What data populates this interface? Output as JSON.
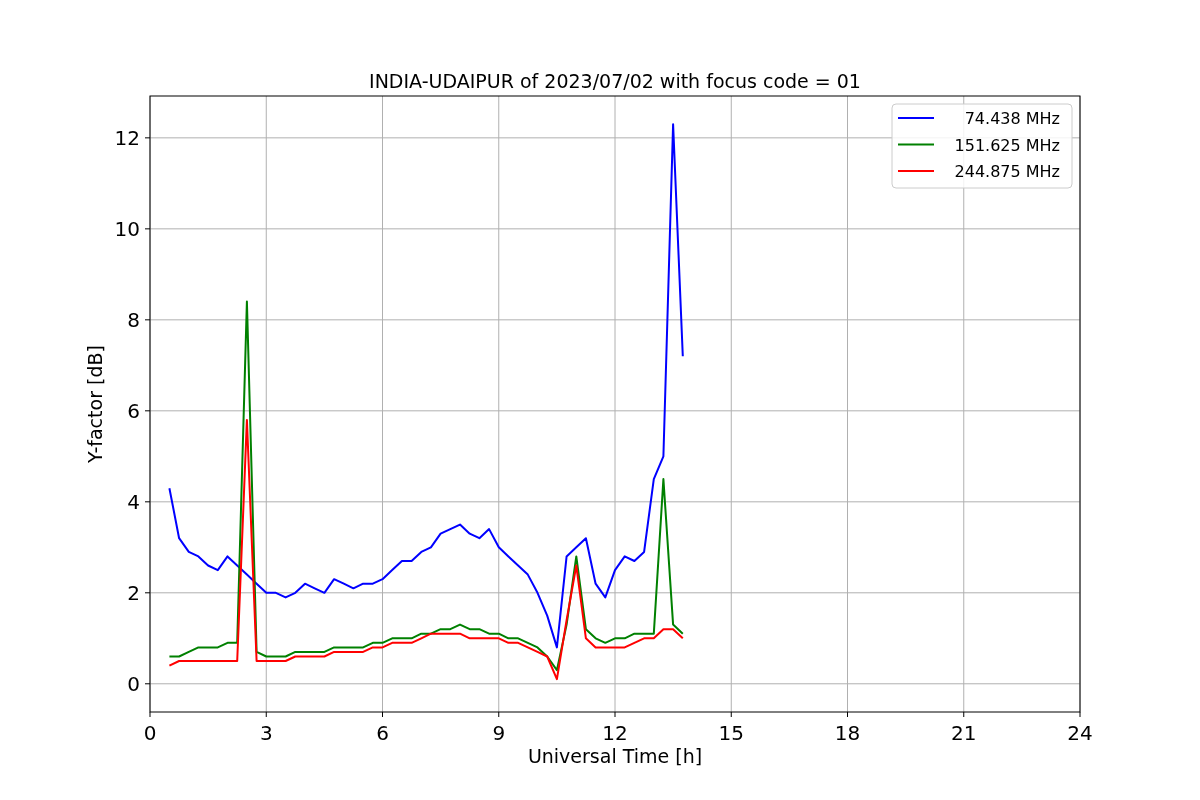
{
  "figure": {
    "chart_data": {
      "type": "line",
      "title": "INDIA-UDAIPUR of 2023/07/02 with focus code = 01",
      "xlabel": "Universal Time [h]",
      "ylabel": "Y-factor [dB]",
      "x": [
        0.5,
        0.75,
        1,
        1.25,
        1.5,
        1.75,
        2,
        2.25,
        2.5,
        2.75,
        3,
        3.25,
        3.5,
        3.75,
        4,
        4.25,
        4.5,
        4.75,
        5,
        5.25,
        5.5,
        5.75,
        6,
        6.25,
        6.5,
        6.75,
        7,
        7.25,
        7.5,
        7.75,
        8,
        8.25,
        8.5,
        8.75,
        9,
        9.25,
        9.5,
        9.75,
        10,
        10.25,
        10.5,
        10.75,
        11,
        11.25,
        11.5,
        11.75,
        12,
        12.25,
        12.5,
        12.75,
        13,
        13.25,
        13.5,
        13.75
      ],
      "series": [
        {
          "name": "74.438 MHz",
          "color": "#0000ff",
          "values": [
            4.3,
            3.2,
            2.9,
            2.8,
            2.6,
            2.5,
            2.8,
            2.6,
            2.4,
            2.2,
            2.0,
            2.0,
            1.9,
            2.0,
            2.2,
            2.1,
            2.0,
            2.3,
            2.2,
            2.1,
            2.2,
            2.2,
            2.3,
            2.5,
            2.7,
            2.7,
            2.9,
            3.0,
            3.3,
            3.4,
            3.5,
            3.3,
            3.2,
            3.4,
            3.0,
            2.8,
            2.6,
            2.4,
            2.0,
            1.5,
            0.8,
            2.8,
            3.0,
            3.2,
            2.2,
            1.9,
            2.5,
            2.8,
            2.7,
            2.9,
            4.5,
            5.0,
            12.3,
            7.2
          ]
        },
        {
          "name": "151.625 MHz",
          "color": "#008000",
          "values": [
            0.6,
            0.6,
            0.7,
            0.8,
            0.8,
            0.8,
            0.9,
            0.9,
            8.4,
            0.7,
            0.6,
            0.6,
            0.6,
            0.7,
            0.7,
            0.7,
            0.7,
            0.8,
            0.8,
            0.8,
            0.8,
            0.9,
            0.9,
            1.0,
            1.0,
            1.0,
            1.1,
            1.1,
            1.2,
            1.2,
            1.3,
            1.2,
            1.2,
            1.1,
            1.1,
            1.0,
            1.0,
            0.9,
            0.8,
            0.6,
            0.3,
            1.3,
            2.8,
            1.2,
            1.0,
            0.9,
            1.0,
            1.0,
            1.1,
            1.1,
            1.1,
            4.5,
            1.3,
            1.1
          ]
        },
        {
          "name": "244.875 MHz",
          "color": "#ff0000",
          "values": [
            0.4,
            0.5,
            0.5,
            0.5,
            0.5,
            0.5,
            0.5,
            0.5,
            5.8,
            0.5,
            0.5,
            0.5,
            0.5,
            0.6,
            0.6,
            0.6,
            0.6,
            0.7,
            0.7,
            0.7,
            0.7,
            0.8,
            0.8,
            0.9,
            0.9,
            0.9,
            1.0,
            1.1,
            1.1,
            1.1,
            1.1,
            1.0,
            1.0,
            1.0,
            1.0,
            0.9,
            0.9,
            0.8,
            0.7,
            0.6,
            0.1,
            1.4,
            2.6,
            1.0,
            0.8,
            0.8,
            0.8,
            0.8,
            0.9,
            1.0,
            1.0,
            1.2,
            1.2,
            1.0
          ]
        }
      ],
      "grid": true,
      "legend": true,
      "xlim": [
        0,
        24
      ],
      "ylim": [
        -0.62,
        12.92
      ],
      "xticks": [
        0,
        3,
        6,
        9,
        12,
        15,
        18,
        21,
        24
      ],
      "yticks": [
        0,
        2,
        4,
        6,
        8,
        10,
        12
      ]
    }
  }
}
